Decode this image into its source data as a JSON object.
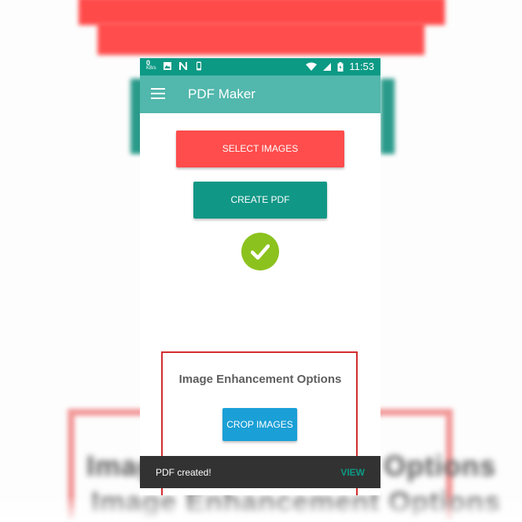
{
  "status_bar": {
    "net_speed": "0",
    "net_unit": "KB/s",
    "time": "11:53",
    "icons": [
      "image-icon",
      "n-icon",
      "phone-icon",
      "wifi-icon",
      "signal-icon",
      "battery-icon"
    ]
  },
  "app_bar": {
    "title": "PDF Maker",
    "menu_icon": "hamburger-menu-icon"
  },
  "main": {
    "select_images_label": "SELECT IMAGES",
    "create_pdf_label": "CREATE PDF",
    "success_icon": "check-circle-icon"
  },
  "enhancement": {
    "title": "Image Enhancement Options",
    "crop_label": "CROP IMAGES"
  },
  "snackbar": {
    "message": "PDF created!",
    "action": "VIEW"
  },
  "background": {
    "blurred_text_1": "Image Enhancement Options",
    "blurred_text_2": "Image Enhancement Options"
  },
  "colors": {
    "status_bar": "#0c9a85",
    "app_bar": "#52b7ac",
    "select_button": "#ff4c4c",
    "create_button": "#119786",
    "success": "#8cc21e",
    "crop_button": "#1a9fd6",
    "highlight_border": "#d32d2d",
    "snackbar": "#323232"
  }
}
